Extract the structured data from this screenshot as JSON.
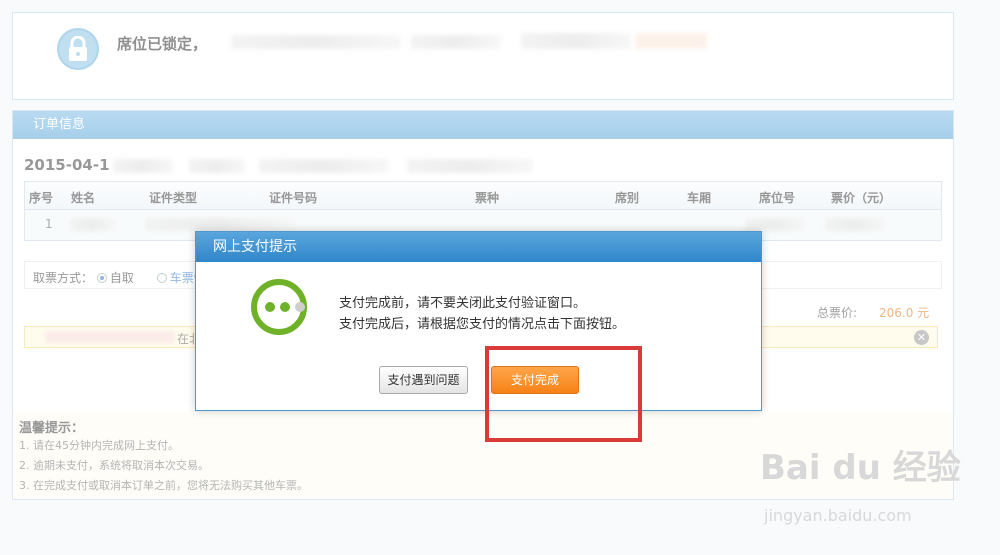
{
  "lock": {
    "icon": "lock-icon",
    "text": "席位已锁定，"
  },
  "order": {
    "title": "订单信息",
    "date_prefix": "2015-04-1",
    "columns": [
      "序号",
      "姓名",
      "证件类型",
      "证件号码",
      "票种",
      "席别",
      "车厢",
      "席位号",
      "票价（元）"
    ],
    "row_index": "1"
  },
  "pickup": {
    "label": "取票方式：",
    "opt_self": "自取",
    "opt_other": "车票快"
  },
  "total": {
    "label": "总票价:",
    "value": "206.0 元"
  },
  "notice": {
    "visible_fragment": "在北"
  },
  "tips": {
    "title": "温馨提示：",
    "items": [
      "1.  请在45分钟内完成网上支付。",
      "2.  逾期未支付，系统将取消本次交易。",
      "3.  在完成支付或取消本订单之前，您将无法购买其他车票。"
    ]
  },
  "dialog": {
    "title": "网上支付提示",
    "line1": "支付完成前，请不要关闭此支付验证窗口。",
    "line2": "支付完成后，请根据您支付的情况点击下面按钮。",
    "btn_problem": "支付遇到问题",
    "btn_done": "支付完成"
  },
  "watermark": {
    "brand": "Bai du 经验",
    "url": "jingyan.baidu.com"
  },
  "colors": {
    "accent_blue": "#4e98cf",
    "orange": "#f68216",
    "green": "#6fb22a",
    "highlight_red": "#d93a3a"
  }
}
